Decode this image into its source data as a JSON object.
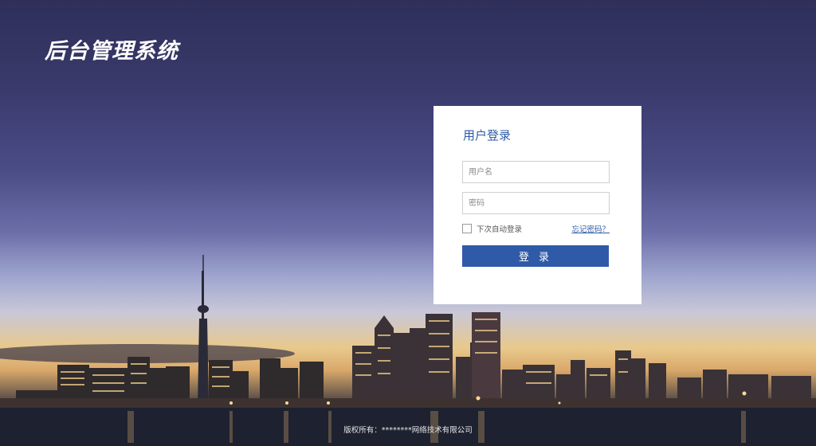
{
  "header": {
    "title": "后台管理系统"
  },
  "login": {
    "title": "用户登录",
    "username_placeholder": "用户名",
    "password_placeholder": "密码",
    "remember_label": "下次自动登录",
    "forgot_label": "忘记密码？",
    "submit_label": "登 录"
  },
  "footer": {
    "copyright": "版权所有：********网络技术有限公司"
  },
  "colors": {
    "accent": "#2e5aa8",
    "title_blue": "#2d5aa6"
  }
}
